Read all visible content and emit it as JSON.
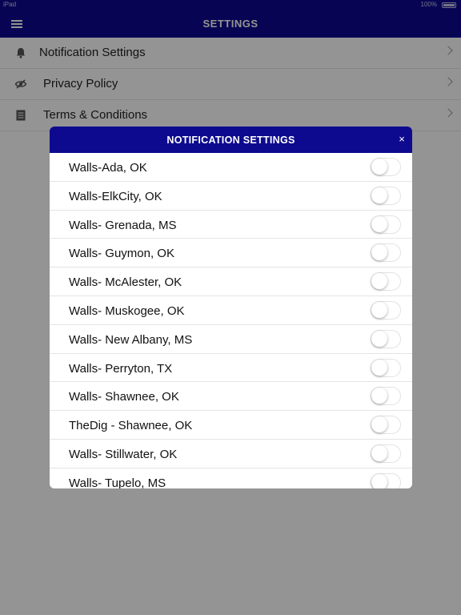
{
  "status_bar": {
    "carrier": "iPad",
    "time": "",
    "battery_pct": "100%"
  },
  "header": {
    "title": "SETTINGS",
    "menu_icon": "hamburger-icon"
  },
  "colors": {
    "brand": "#0d0a8f",
    "overlay": "rgba(0,0,0,0.42)"
  },
  "settings": {
    "items": [
      {
        "label": "Notification Settings",
        "icon": "bell-icon"
      },
      {
        "label": "Privacy Policy",
        "icon": "eye-slash-icon"
      },
      {
        "label": "Terms & Conditions",
        "icon": "document-icon"
      }
    ]
  },
  "dialog": {
    "title": "NOTIFICATION SETTINGS",
    "close_symbol": "×",
    "locations": [
      {
        "label": "Walls-Ada, OK",
        "enabled": false
      },
      {
        "label": "Walls-ElkCity, OK",
        "enabled": false
      },
      {
        "label": "Walls- Grenada, MS",
        "enabled": false
      },
      {
        "label": "Walls- Guymon, OK",
        "enabled": false
      },
      {
        "label": "Walls- McAlester, OK",
        "enabled": false
      },
      {
        "label": "Walls- Muskogee, OK",
        "enabled": false
      },
      {
        "label": "Walls- New Albany, MS",
        "enabled": false
      },
      {
        "label": "Walls- Perryton, TX",
        "enabled": false
      },
      {
        "label": "Walls- Shawnee, OK",
        "enabled": false
      },
      {
        "label": "TheDig - Shawnee, OK",
        "enabled": false
      },
      {
        "label": "Walls- Stillwater, OK",
        "enabled": false
      },
      {
        "label": "Walls- Tupelo, MS",
        "enabled": false
      }
    ]
  }
}
